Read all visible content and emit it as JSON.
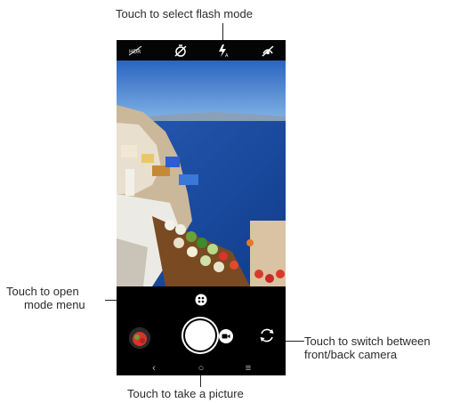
{
  "callouts": {
    "flash": "Touch to select flash mode",
    "mode_menu_line1": "Touch to open",
    "mode_menu_line2": "mode menu",
    "switch_line1": "Touch to switch between",
    "switch_line2": "front/back camera",
    "shutter": "Touch to take a picture"
  },
  "top_bar": {
    "icons": [
      "hdr-off-icon",
      "timer-off-icon",
      "flash-auto-icon",
      "beauty-off-icon"
    ]
  },
  "controls": {
    "mode_menu_icon": "grid-dots-icon",
    "gallery_thumbnail": "last-photo-thumbnail",
    "shutter_icon": "shutter-button",
    "video_icon": "video-camera-icon",
    "switch_icon": "camera-switch-icon"
  },
  "nav_bar": {
    "back": "‹",
    "home": "○",
    "recents": "≡"
  },
  "colors": {
    "phone_bg": "#000000",
    "sky": "#2f6fc4",
    "sea": "#1d4fa6",
    "cliff": "#d8d0c4",
    "label_text": "#2b2b2b"
  }
}
